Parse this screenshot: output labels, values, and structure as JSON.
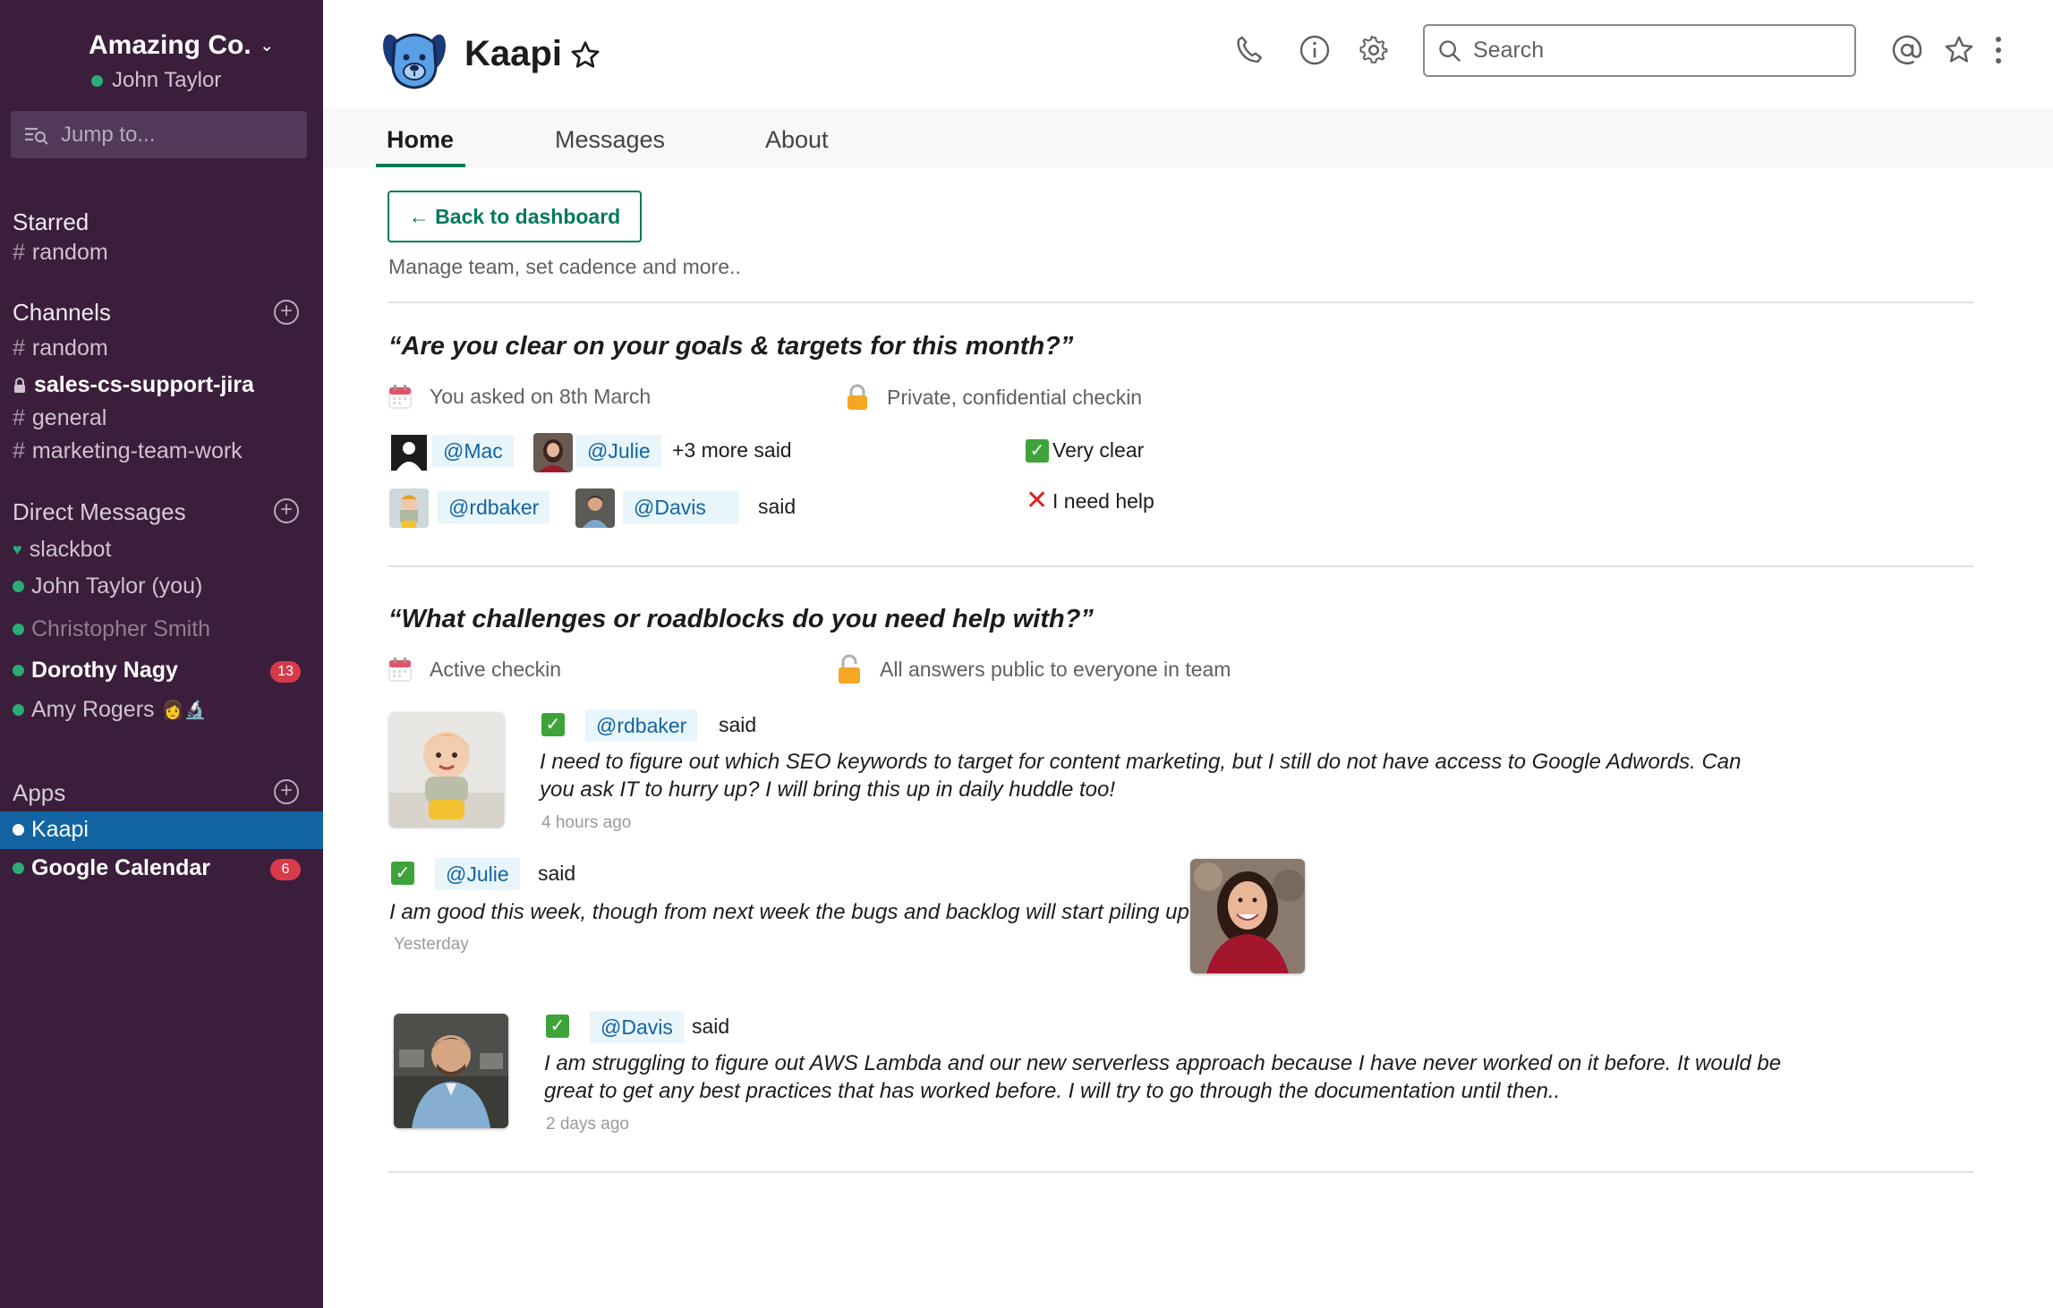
{
  "sidebar": {
    "workspace": "Amazing Co.",
    "user": "John Taylor",
    "jump_to": "Jump to...",
    "starred": {
      "title": "Starred",
      "items": [
        "random"
      ]
    },
    "channels": {
      "title": "Channels",
      "items": [
        "random",
        "sales-cs-support-jira",
        "general",
        "marketing-team-work"
      ]
    },
    "direct_messages": {
      "title": "Direct Messages",
      "items": [
        {
          "label": "slackbot"
        },
        {
          "label": "John Taylor (you)"
        },
        {
          "label": "Christopher Smith"
        },
        {
          "label": "Dorothy Nagy",
          "badge": "13"
        },
        {
          "label": "Amy Rogers"
        }
      ]
    },
    "apps": {
      "title": "Apps",
      "items": [
        {
          "label": "Kaapi"
        },
        {
          "label": "Google Calendar",
          "badge": "6"
        }
      ]
    }
  },
  "header": {
    "title": "Kaapi",
    "search_placeholder": "Search"
  },
  "tabs": [
    "Home",
    "Messages",
    "About"
  ],
  "main": {
    "back_button": "← Back to dashboard",
    "subtitle": "Manage team, set cadence and more..",
    "checkin1": {
      "question": "“Are you clear on your goals & targets for this month?”",
      "asked": "You asked on 8th March",
      "privacy": "Private, confidential checkin",
      "row1": {
        "mentions": [
          "@Mac",
          "@Julie"
        ],
        "suffix": "+3 more said",
        "answer": "Very clear"
      },
      "row2": {
        "mentions": [
          "@rdbaker",
          "@Davis"
        ],
        "suffix": "said",
        "answer": "I need help"
      }
    },
    "checkin2": {
      "question": "“What challenges or roadblocks do you need help with?”",
      "status": "Active checkin",
      "privacy": "All answers public to everyone in team",
      "responses": [
        {
          "mention": "@rdbaker",
          "said": "said",
          "text_line1": "I need to figure out which SEO keywords to target for content marketing, but I still do not have access to Google Adwords. Can",
          "text_line2": "you ask IT to hurry up? I will bring this up in daily huddle too!",
          "time": "4 hours ago"
        },
        {
          "mention": "@Julie",
          "said": "said",
          "text_line1": "I am good this week, though from next week the bugs and backlog will start piling up",
          "time": "Yesterday"
        },
        {
          "mention": "@Davis",
          "said": "said",
          "text_line1": "I am struggling to figure out AWS Lambda and our new serverless approach because I have never worked on it before. It would be",
          "text_line2": "great to get any best practices that has worked before. I will try to go through the documentation until then..",
          "time": "2 days ago"
        }
      ]
    }
  },
  "colors": {
    "sidebar_bg": "#3a1e3b",
    "active_item": "#1264a3",
    "accent_green": "#007a5a",
    "badge_red": "#d73a49",
    "mention_bg": "#e8f5fa",
    "mention_text": "#1264a3"
  }
}
